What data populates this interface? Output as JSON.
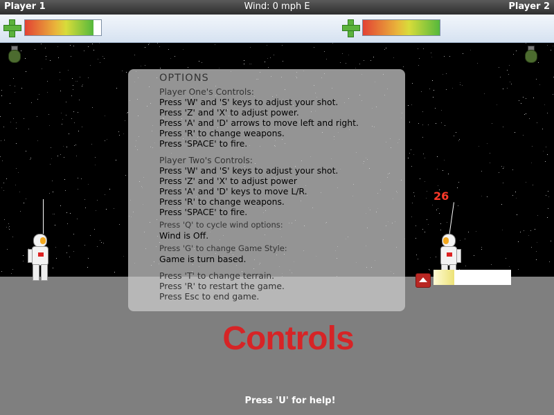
{
  "topbar": {
    "player1": "Player 1",
    "wind": "Wind: 0 mph E",
    "player2": "Player 2"
  },
  "hud": {
    "p1_health_pct": 90,
    "p2_health_pct": 100
  },
  "options": {
    "title": "OPTIONS",
    "p1_heading": "Player One's Controls:",
    "p1_lines": [
      "Press 'W' and 'S' keys to adjust your shot.",
      "Press 'Z' and 'X' to adjust power.",
      "Press 'A' and 'D' arrows to move left and right.",
      "Press 'R' to change weapons.",
      "Press 'SPACE' to fire."
    ],
    "p2_heading": "Player Two's Controls:",
    "p2_lines": [
      "Press 'W' and 'S' keys to adjust your shot.",
      "Press 'Z' and 'X' to adjust power",
      "Press 'A' and 'D' keys to move L/R.",
      "Press 'R' to change weapons.",
      "Press 'SPACE' to fire."
    ],
    "wind_hint": "Press 'Q' to cycle wind options:",
    "wind_state": "Wind is Off.",
    "style_hint": "Press 'G' to change Game Style:",
    "style_state": "Game is turn based.",
    "misc_lines": [
      "Press 'T' to change terrain.",
      "Press 'R' to restart the game.",
      "Press Esc to end game."
    ]
  },
  "banner": "Controls",
  "help": "Press 'U' for help!",
  "damage": "26",
  "power_pct": 27
}
